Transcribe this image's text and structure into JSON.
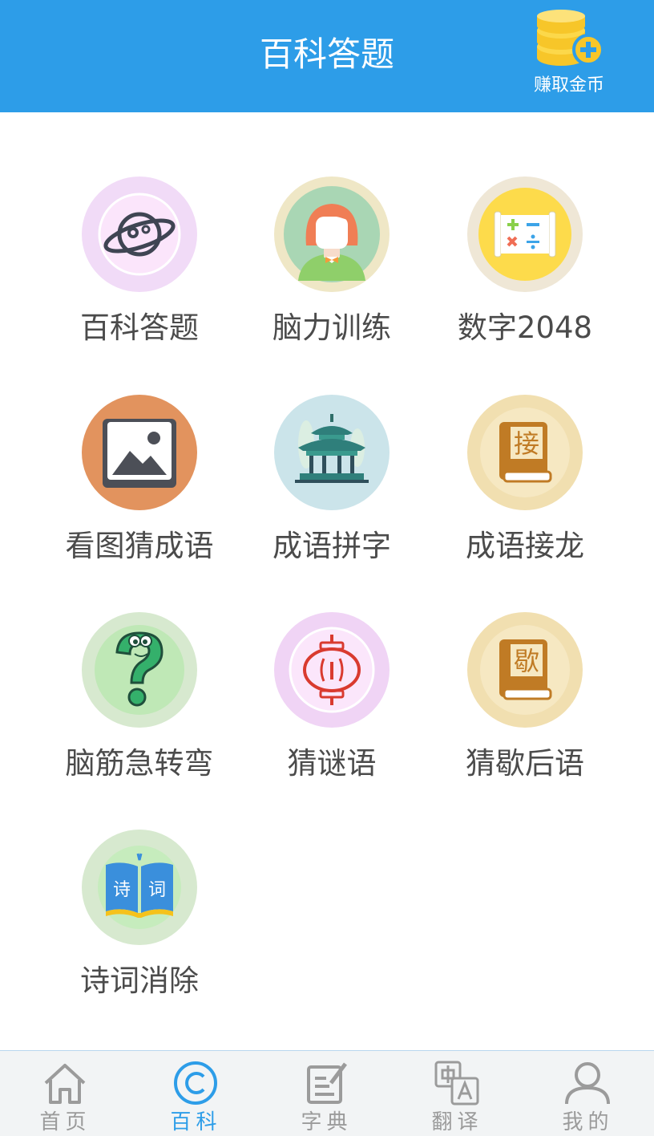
{
  "header": {
    "title": "百科答题",
    "earn_label": "赚取金币"
  },
  "tiles": [
    {
      "label": "百科答题",
      "icon": "planet-icon"
    },
    {
      "label": "脑力训练",
      "icon": "girl-avatar-icon"
    },
    {
      "label": "数字2048",
      "icon": "math-board-icon"
    },
    {
      "label": "看图猜成语",
      "icon": "picture-icon"
    },
    {
      "label": "成语拼字",
      "icon": "pavilion-icon"
    },
    {
      "label": "成语接龙",
      "icon": "book-jie-icon",
      "glyph": "接"
    },
    {
      "label": "脑筋急转弯",
      "icon": "question-mark-icon"
    },
    {
      "label": "猜谜语",
      "icon": "lantern-icon"
    },
    {
      "label": "猜歇后语",
      "icon": "book-xie-icon",
      "glyph": "歇"
    },
    {
      "label": "诗词消除",
      "icon": "open-book-icon",
      "glyphs": [
        "诗",
        "词"
      ]
    }
  ],
  "tabbar": {
    "tabs": [
      {
        "label": "首页",
        "icon": "home-icon",
        "active": false
      },
      {
        "label": "百科",
        "icon": "copyright-icon",
        "active": true
      },
      {
        "label": "字典",
        "icon": "edit-note-icon",
        "active": false
      },
      {
        "label": "翻译",
        "icon": "translate-icon",
        "active": false
      },
      {
        "label": "我的",
        "icon": "user-icon",
        "active": false
      }
    ]
  },
  "colors": {
    "primary": "#2d9de8",
    "tab_inactive": "#9b9b9b",
    "label_text": "#4b4b4b"
  }
}
